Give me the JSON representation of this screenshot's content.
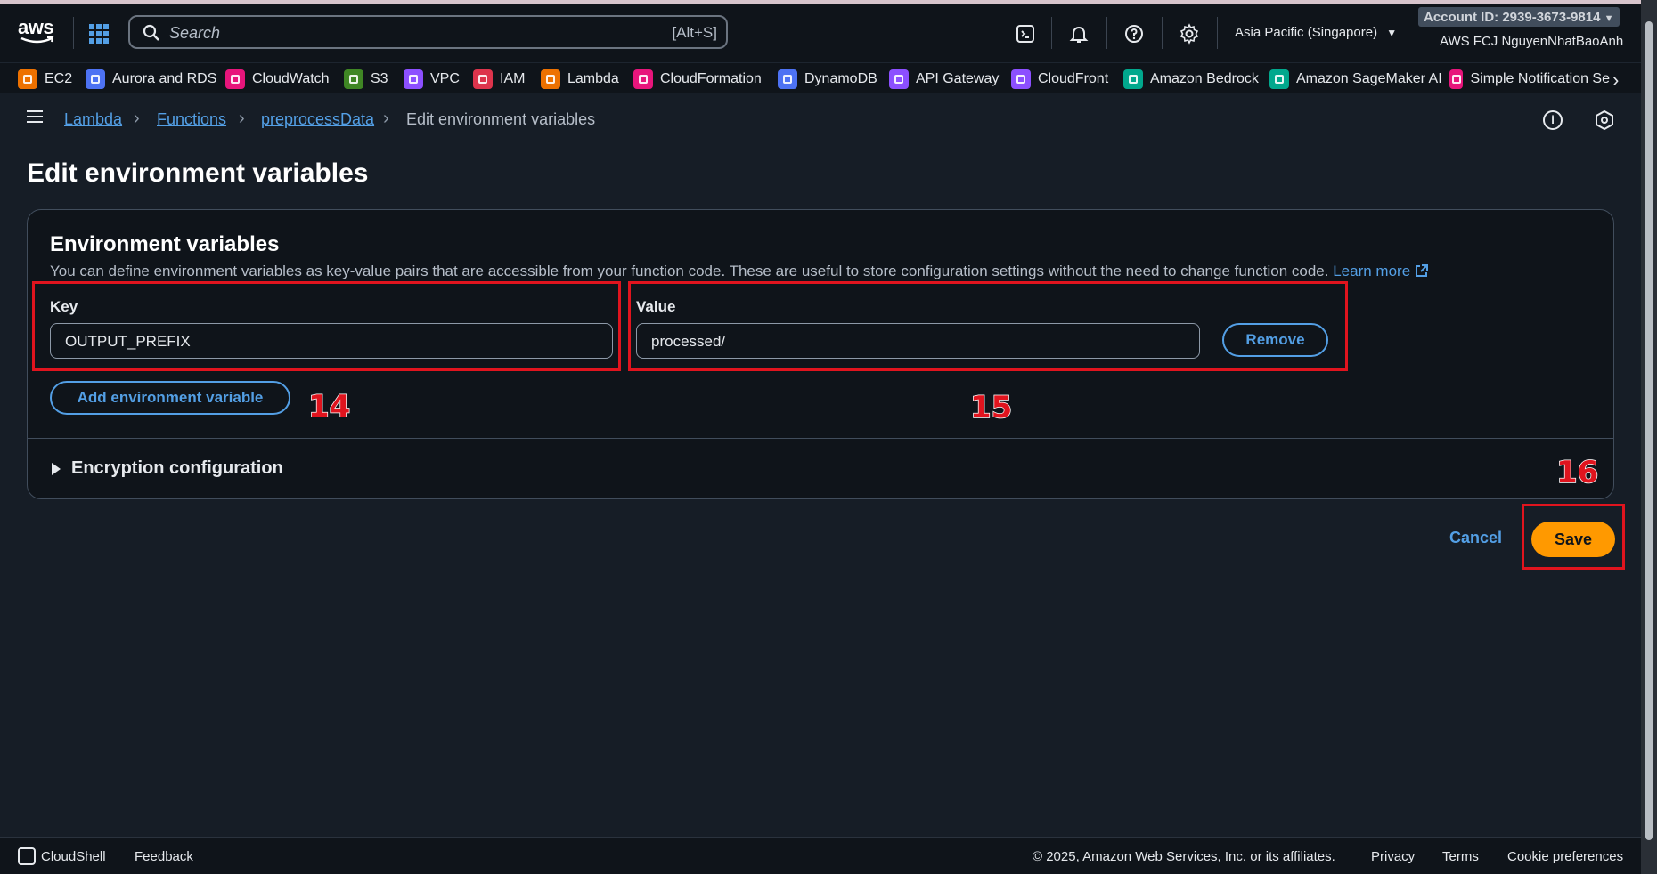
{
  "nav": {
    "logo_text": "aws",
    "search_placeholder": "Search",
    "search_shortcut": "[Alt+S]",
    "region": "Asia Pacific (Singapore)",
    "account_id": "Account ID: 2939-3673-9814",
    "account_name": "AWS FCJ NguyenNhatBaoAnh"
  },
  "favorites": [
    {
      "label": "EC2",
      "color": "#ed7100"
    },
    {
      "label": "Aurora and RDS",
      "color": "#4d72f3"
    },
    {
      "label": "CloudWatch",
      "color": "#e7157b"
    },
    {
      "label": "S3",
      "color": "#3f8624"
    },
    {
      "label": "VPC",
      "color": "#8c4fff"
    },
    {
      "label": "IAM",
      "color": "#dd344c"
    },
    {
      "label": "Lambda",
      "color": "#ed7100"
    },
    {
      "label": "CloudFormation",
      "color": "#e7157b"
    },
    {
      "label": "DynamoDB",
      "color": "#4d72f3"
    },
    {
      "label": "API Gateway",
      "color": "#8c4fff"
    },
    {
      "label": "CloudFront",
      "color": "#8c4fff"
    },
    {
      "label": "Amazon Bedrock",
      "color": "#01a88d"
    },
    {
      "label": "Amazon SageMaker AI",
      "color": "#01a88d"
    },
    {
      "label": "Simple Notification Se",
      "color": "#e7157b"
    }
  ],
  "breadcrumb": {
    "items": [
      "Lambda",
      "Functions",
      "preprocessData"
    ],
    "current": "Edit environment variables"
  },
  "page": {
    "title": "Edit environment variables"
  },
  "env": {
    "title": "Environment variables",
    "description": "You can define environment variables as key-value pairs that are accessible from your function code. These are useful to store configuration settings without the need to change function code.",
    "learn_more": "Learn more",
    "key_label": "Key",
    "key_value": "OUTPUT_PREFIX",
    "value_label": "Value",
    "value_value": "processed/",
    "remove_label": "Remove",
    "add_label": "Add environment variable",
    "encryption_label": "Encryption configuration"
  },
  "annotations": {
    "a14": "14",
    "a15": "15",
    "a16": "16"
  },
  "actions": {
    "cancel": "Cancel",
    "save": "Save"
  },
  "footer": {
    "cloudshell": "CloudShell",
    "feedback": "Feedback",
    "copyright": "© 2025, Amazon Web Services, Inc. or its affiliates.",
    "privacy": "Privacy",
    "terms": "Terms",
    "cookies": "Cookie preferences"
  },
  "colors": {
    "accent": "#539fe5",
    "primary_button": "#ff9900",
    "annotation": "#e0141e"
  }
}
